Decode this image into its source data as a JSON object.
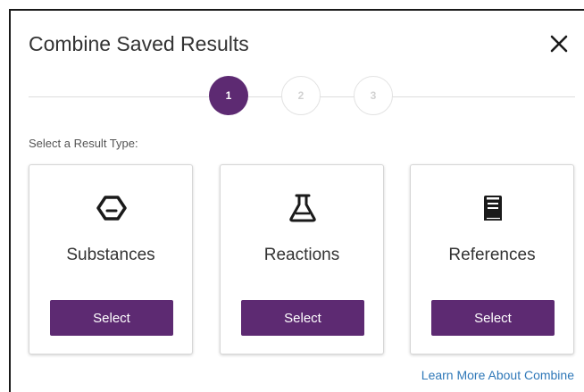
{
  "dialog": {
    "title": "Combine Saved Results",
    "close_icon": "close-icon"
  },
  "stepper": {
    "steps": [
      {
        "label": "1",
        "state": "active"
      },
      {
        "label": "2",
        "state": "inactive"
      },
      {
        "label": "3",
        "state": "inactive"
      }
    ]
  },
  "prompt": "Select a Result Type:",
  "cards": [
    {
      "label": "Substances",
      "icon": "hexagon-icon",
      "button_label": "Select"
    },
    {
      "label": "Reactions",
      "icon": "flask-icon",
      "button_label": "Select"
    },
    {
      "label": "References",
      "icon": "document-icon",
      "button_label": "Select"
    }
  ],
  "footer": {
    "link_text": "Learn More About Combine"
  },
  "colors": {
    "accent": "#5d2a72",
    "link": "#2f78b8",
    "text": "#333333"
  }
}
